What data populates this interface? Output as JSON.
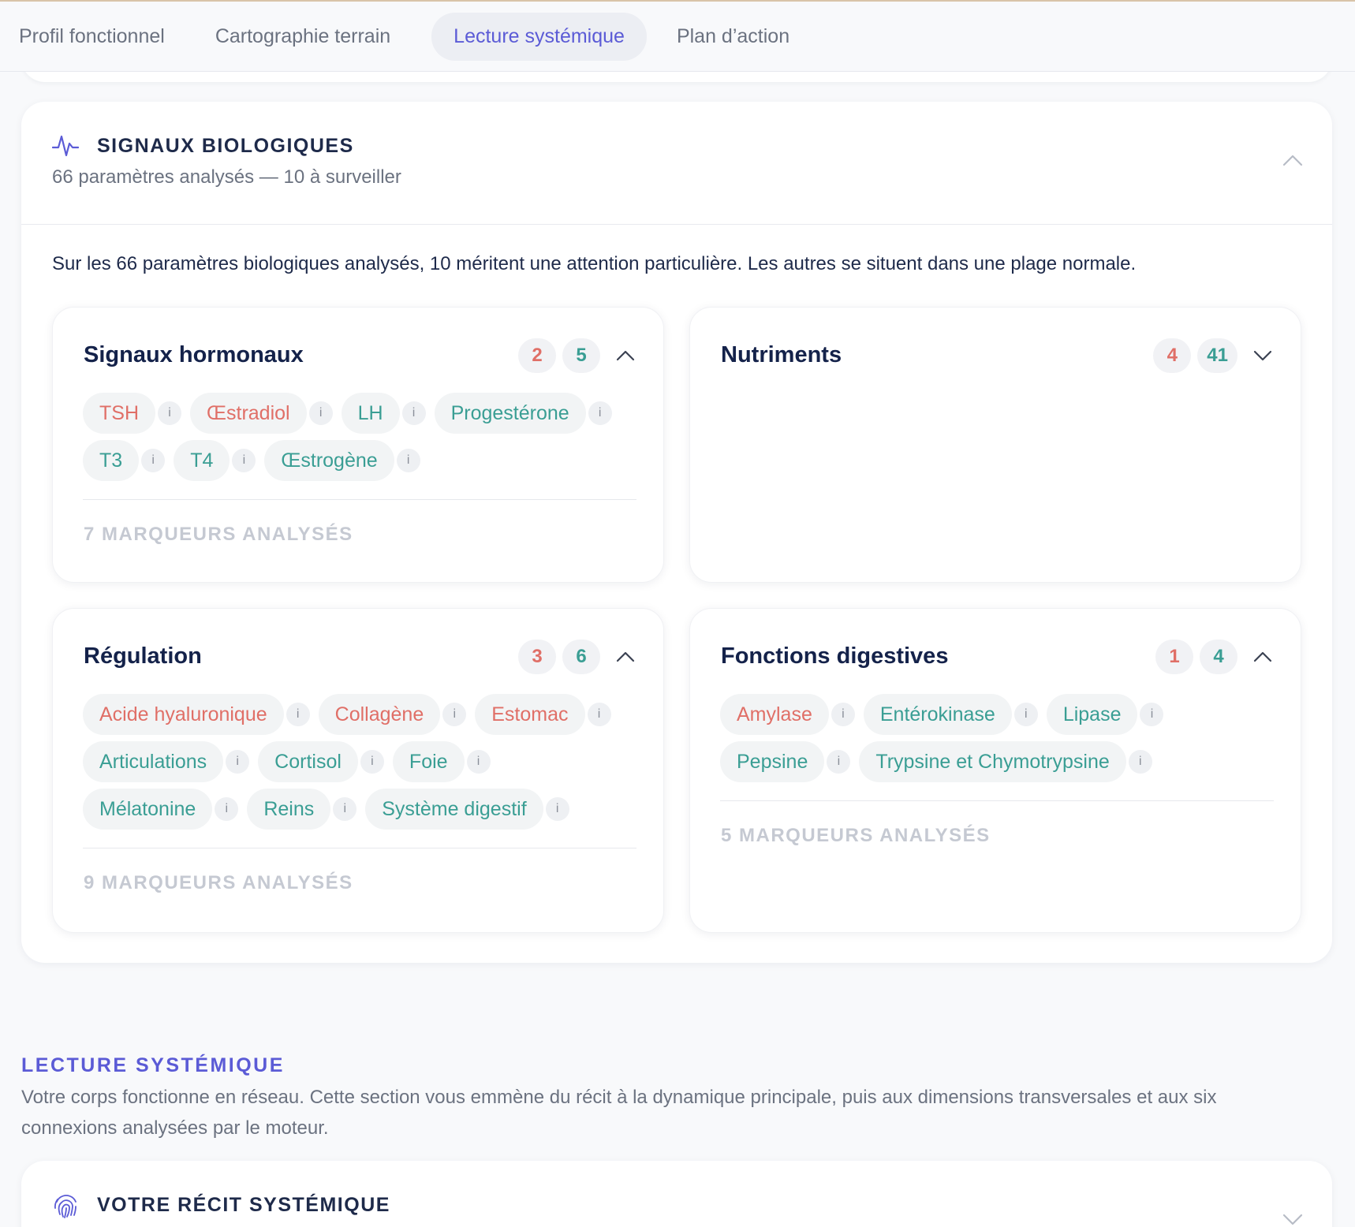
{
  "tabs": [
    {
      "label": "Profil fonctionnel",
      "active": false
    },
    {
      "label": "Cartographie terrain",
      "active": false
    },
    {
      "label": "Lecture systémique",
      "active": true
    },
    {
      "label": "Plan d’action",
      "active": false
    }
  ],
  "colors": {
    "accent": "#5b5bd6",
    "alert": "#e06f67",
    "normal": "#3a9e94"
  },
  "bio": {
    "title": "SIGNAUX BIOLOGIQUES",
    "subtitle": "66 paramètres analysés — 10 à surveiller",
    "intro": "Sur les 66 paramètres biologiques analysés, 10 méritent une attention particulière. Les autres se situent dans une plage normale.",
    "cards": [
      {
        "title": "Signaux hormonaux",
        "alert_count": "2",
        "normal_count": "5",
        "expanded": true,
        "chips": [
          {
            "label": "TSH",
            "status": "alert"
          },
          {
            "label": "Œstradiol",
            "status": "alert"
          },
          {
            "label": "LH",
            "status": "normal"
          },
          {
            "label": "Progestérone",
            "status": "normal"
          },
          {
            "label": "T3",
            "status": "normal"
          },
          {
            "label": "T4",
            "status": "normal"
          },
          {
            "label": "Œstrogène",
            "status": "normal"
          }
        ],
        "footer": "7 MARQUEURS ANALYSÉS"
      },
      {
        "title": "Nutriments",
        "alert_count": "4",
        "normal_count": "41",
        "expanded": false,
        "chips": [],
        "footer": ""
      },
      {
        "title": "Régulation",
        "alert_count": "3",
        "normal_count": "6",
        "expanded": true,
        "chips": [
          {
            "label": "Acide hyaluronique",
            "status": "alert"
          },
          {
            "label": "Collagène",
            "status": "alert"
          },
          {
            "label": "Estomac",
            "status": "alert"
          },
          {
            "label": "Articulations",
            "status": "normal"
          },
          {
            "label": "Cortisol",
            "status": "normal"
          },
          {
            "label": "Foie",
            "status": "normal"
          },
          {
            "label": "Mélatonine",
            "status": "normal"
          },
          {
            "label": "Reins",
            "status": "normal"
          },
          {
            "label": "Système digestif",
            "status": "normal"
          }
        ],
        "footer": "9 MARQUEURS ANALYSÉS"
      },
      {
        "title": "Fonctions digestives",
        "alert_count": "1",
        "normal_count": "4",
        "expanded": true,
        "chips": [
          {
            "label": "Amylase",
            "status": "alert"
          },
          {
            "label": "Entérokinase",
            "status": "normal"
          },
          {
            "label": "Lipase",
            "status": "normal"
          },
          {
            "label": "Pepsine",
            "status": "normal"
          },
          {
            "label": "Trypsine et Chymotrypsine",
            "status": "normal"
          }
        ],
        "footer": "5 MARQUEURS ANALYSÉS"
      }
    ]
  },
  "info_glyph": "i",
  "section": {
    "label": "LECTURE SYSTÉMIQUE",
    "description": "Votre corps fonctionne en réseau. Cette section vous emmène du récit à la dynamique principale, puis aux dimensions transversales et aux six connexions analysées par le moteur."
  },
  "recit": {
    "title": "VOTRE RÉCIT SYSTÉMIQUE",
    "icon": "fingerprint-icon"
  }
}
